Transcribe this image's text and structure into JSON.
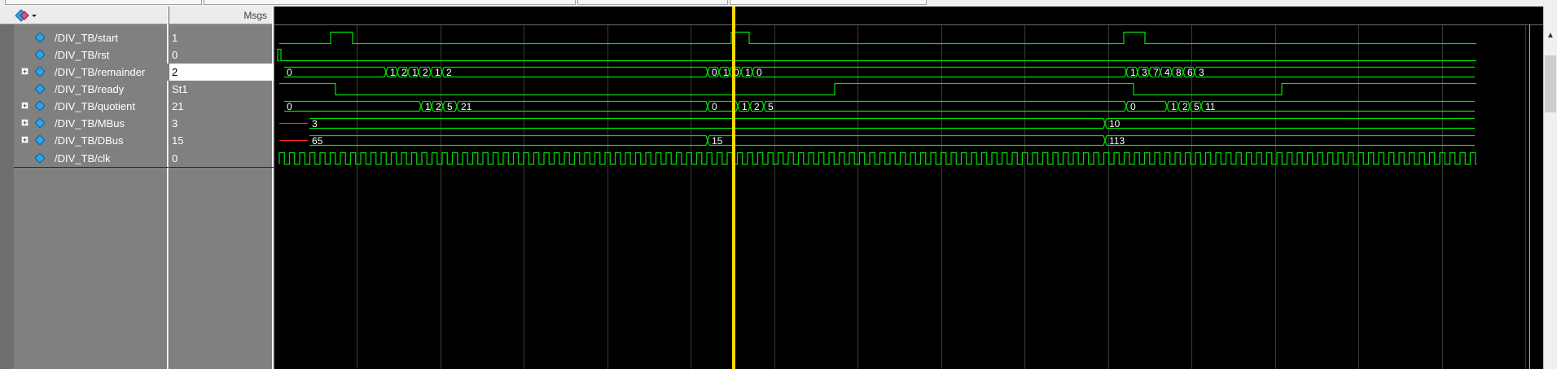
{
  "header": {
    "msgs_label": "Msgs"
  },
  "signals": [
    {
      "name": "/DIV_TB/start",
      "value": "1",
      "expandable": false
    },
    {
      "name": "/DIV_TB/rst",
      "value": "0",
      "expandable": false
    },
    {
      "name": "/DIV_TB/remainder",
      "value": "2",
      "expandable": true
    },
    {
      "name": "/DIV_TB/ready",
      "value": "St1",
      "expandable": false
    },
    {
      "name": "/DIV_TB/quotient",
      "value": "21",
      "expandable": true
    },
    {
      "name": "/DIV_TB/MBus",
      "value": "3",
      "expandable": true
    },
    {
      "name": "/DIV_TB/DBus",
      "value": "15",
      "expandable": true
    },
    {
      "name": "/DIV_TB/clk",
      "value": "0",
      "expandable": false
    }
  ],
  "bus_labels": {
    "remainder": [
      "0",
      "1",
      "2",
      "1",
      "2",
      "1",
      "2",
      "0",
      "1",
      "0",
      "1",
      "0",
      "1",
      "3",
      "7",
      "4",
      "8",
      "6",
      "3"
    ],
    "quotient": [
      "0",
      "1",
      "2",
      "5",
      "21",
      "0",
      "1",
      "2",
      "5",
      "0",
      "1",
      "2",
      "5",
      "11"
    ],
    "MBus": [
      "3",
      "10"
    ],
    "DBus": [
      "65",
      "15",
      "113"
    ]
  },
  "colors": {
    "wave": "#00e000",
    "cursor": "#ffd800",
    "undefined": "#ff2020",
    "grid": "#3a3a3a",
    "diamond": "#2aa7e8"
  }
}
